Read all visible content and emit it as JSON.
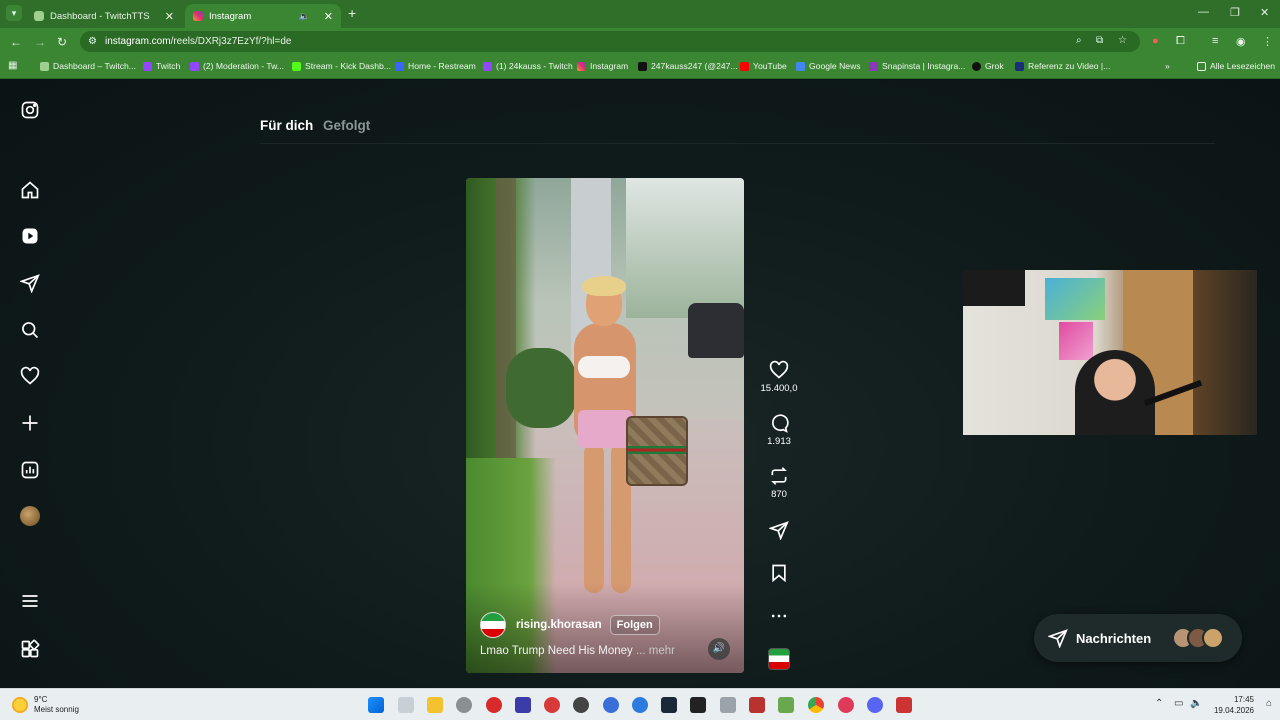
{
  "browser": {
    "tabs": [
      {
        "title": "Dashboard - TwitchTTS",
        "active": false
      },
      {
        "title": "Instagram",
        "active": true
      }
    ],
    "url_host": "instagram.com",
    "url_path": "/reels/DXRj3z7EzYf/?hl=de",
    "bookmarks": [
      "Dashboard – Twitch...",
      "Twitch",
      "(2) Moderation - Tw...",
      "Stream - Kick Dashb...",
      "Home - Restream",
      "(1) 24kauss - Twitch",
      "Instagram",
      "247kauss247 (@247...",
      "YouTube",
      "Google News",
      "Snapinsta | Instagra...",
      "Grok",
      "Referenz zu Video |..."
    ],
    "all_bookmarks": "Alle Lesezeichen"
  },
  "feed": {
    "tab_for_you": "Für dich",
    "tab_following": "Gefolgt"
  },
  "reel": {
    "username": "rising.khorasan",
    "follow_label": "Folgen",
    "caption": "Lmao Trump Need His Money",
    "more_label": "... mehr",
    "likes": "15.400,0",
    "comments": "1.913",
    "reposts": "870"
  },
  "messages": {
    "label": "Nachrichten"
  },
  "taskbar": {
    "temperature": "9°C",
    "weather": "Meist sonnig",
    "time": "17:45",
    "date": "19.04.2026"
  },
  "colors": {
    "chrome_green": "#3a8633",
    "page_bg": "#0b1414",
    "messages_bg": "#1f2b2b"
  }
}
